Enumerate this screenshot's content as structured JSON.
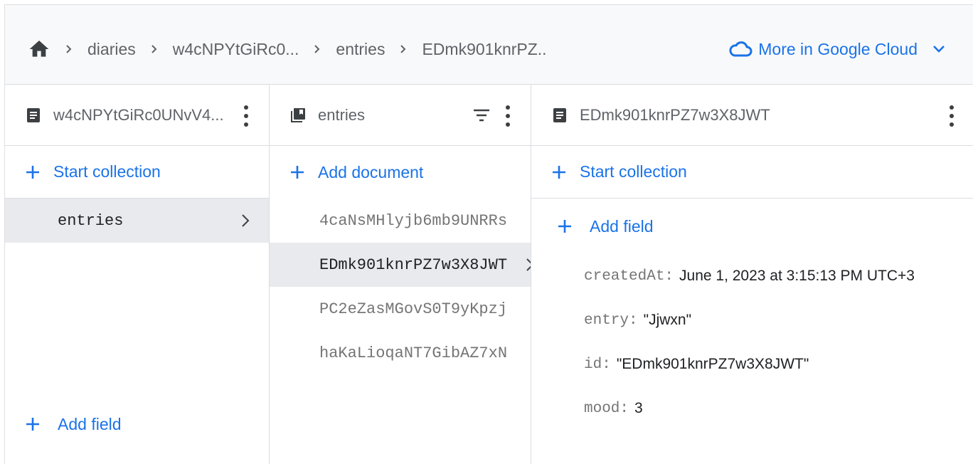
{
  "breadcrumb": {
    "home_icon": "home-icon",
    "items": [
      "diaries",
      "w4cNPYtGiRc0...",
      "entries",
      "EDmk901knrPZ.."
    ],
    "separator_icon": "chevron-right-icon"
  },
  "cloud_menu": {
    "label": "More in Google Cloud",
    "icon": "cloud-icon",
    "dropdown_icon": "chevron-down-icon"
  },
  "panels": {
    "root_doc": {
      "title": "w4cNPYtGiRc0UNvV4...",
      "icon": "document-icon",
      "start_collection": "Start collection",
      "collections": [
        {
          "label": "entries",
          "selected": true
        }
      ],
      "add_field": "Add field"
    },
    "collection": {
      "title": "entries",
      "icon": "collection-icon",
      "add_document": "Add document",
      "documents": [
        {
          "label": "4caNsMHlyjb6mb9UNRRs",
          "selected": false
        },
        {
          "label": "EDmk901knrPZ7w3X8JWT",
          "selected": true
        },
        {
          "label": "PC2eZasMGovS0T9yKpzj",
          "selected": false
        },
        {
          "label": "haKaLioqaNT7GibAZ7xN",
          "selected": false
        }
      ]
    },
    "document": {
      "title": "EDmk901knrPZ7w3X8JWT",
      "icon": "document-icon",
      "start_collection": "Start collection",
      "add_field": "Add field",
      "fields": [
        {
          "key": "createdAt",
          "value": "June 1, 2023 at 3:15:13 PM UTC+3"
        },
        {
          "key": "entry",
          "value": "\"Jjwxn\""
        },
        {
          "key": "id",
          "value": "\"EDmk901knrPZ7w3X8JWT\""
        },
        {
          "key": "mood",
          "value": "3"
        }
      ]
    }
  },
  "colors": {
    "accent": "#1a73e8",
    "selected_bg": "#e8eaed",
    "header_bg": "#f8f9fa",
    "border": "#dadce0"
  }
}
